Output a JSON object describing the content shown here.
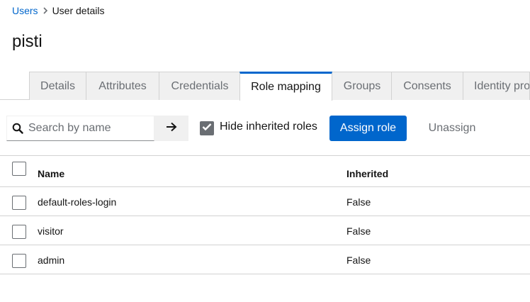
{
  "breadcrumb": {
    "parent": "Users",
    "current": "User details"
  },
  "page": {
    "title": "pisti"
  },
  "tabs": [
    {
      "label": "Details",
      "active": false
    },
    {
      "label": "Attributes",
      "active": false
    },
    {
      "label": "Credentials",
      "active": false
    },
    {
      "label": "Role mapping",
      "active": true
    },
    {
      "label": "Groups",
      "active": false
    },
    {
      "label": "Consents",
      "active": false
    },
    {
      "label": "Identity pro",
      "active": false
    }
  ],
  "toolbar": {
    "search_placeholder": "Search by name",
    "search_value": "",
    "hide_inherited_label": "Hide inherited roles",
    "hide_inherited_checked": true,
    "assign_label": "Assign role",
    "unassign_label": "Unassign"
  },
  "table": {
    "columns": {
      "name": "Name",
      "inherited": "Inherited"
    },
    "rows": [
      {
        "name": "default-roles-login",
        "inherited": "False"
      },
      {
        "name": "visitor",
        "inherited": "False"
      },
      {
        "name": "admin",
        "inherited": "False"
      }
    ]
  },
  "icons": {
    "breadcrumb_separator": "chevron-right-icon",
    "search": "search-icon",
    "search_submit": "arrow-right-icon",
    "checkbox_checked": "check-icon"
  },
  "colors": {
    "link": "#0066cc",
    "primary_button": "#0066cc",
    "active_tab_border": "#0066cc",
    "checkbox_checked": "#6a6e73"
  }
}
